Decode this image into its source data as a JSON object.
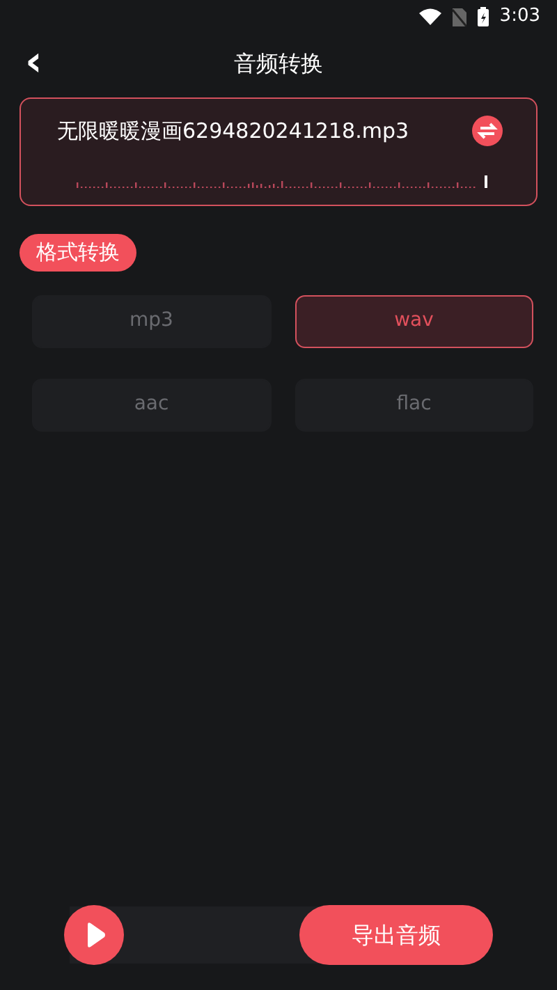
{
  "status_bar": {
    "time": "3:03"
  },
  "header": {
    "back": "‹",
    "title": "音频转换"
  },
  "file": {
    "name": "无限暖暖漫画6294820241218.mp3"
  },
  "section": {
    "label": "格式转换"
  },
  "formats": [
    {
      "label": "mp3",
      "selected": false
    },
    {
      "label": "wav",
      "selected": true
    },
    {
      "label": "aac",
      "selected": false
    },
    {
      "label": "flac",
      "selected": false
    }
  ],
  "export_button": "导出音频"
}
